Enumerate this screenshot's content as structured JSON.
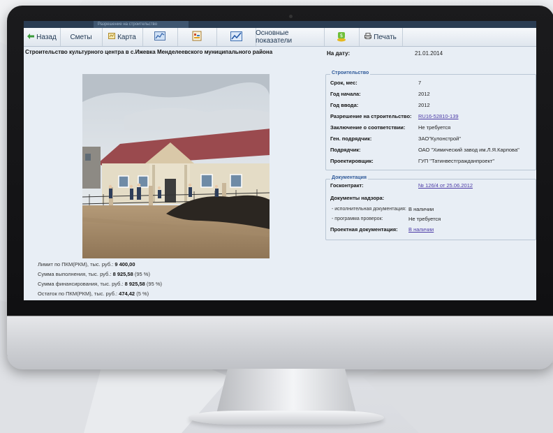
{
  "tab_fragment": "Разрешение на строительство",
  "toolbar": {
    "back_label": "Назад",
    "estimates_label": "Сметы",
    "map_label": "Карта",
    "indicators_label": "Основные показатели",
    "print_label": "Печать"
  },
  "page": {
    "title": "Строительство культурного центра в с.Ижевка Менделеевского муниципального района",
    "date_label": "На дату:",
    "date_value": "21.01.2014"
  },
  "construction": {
    "legend": "Строительство",
    "rows": [
      {
        "label": "Срок, мес:",
        "value": "7"
      },
      {
        "label": "Год начала:",
        "value": "2012"
      },
      {
        "label": "Год ввода:",
        "value": "2012"
      },
      {
        "label": "Разрешение на строительство:",
        "value": "RU16-52810-139"
      },
      {
        "label": "Заключение о соответствии:",
        "value": "Не требуется"
      },
      {
        "label": "Ген. подрядчик:",
        "value": "ЗАО\"Кулонстрой\""
      },
      {
        "label": "Подрядчик:",
        "value": "ОАО \"Химический завод им.Л.Я.Карпова\""
      },
      {
        "label": "Проектировщик:",
        "value": "ГУП \"Татинвестгражданпроект\""
      }
    ]
  },
  "documentation": {
    "legend": "Документация",
    "contract_label": "Госконтракт:",
    "contract_value": "№ 126/4 от 25.06.2012",
    "supervision_label": "Документы надзора:",
    "exec_label": "- исполнительная документация:",
    "exec_value": "В наличии",
    "inspect_label": "- программа проверок:",
    "inspect_value": "Не требуется",
    "project_label": "Проектная документация:",
    "project_value": "В наличии"
  },
  "finance": {
    "limit_label": "Лимит по ПКМ(РКМ), тыс. руб.:",
    "limit_value": "9 400,00",
    "done_label": "Сумма выполнения, тыс. руб.:",
    "done_value": "8 925,58",
    "done_pct": "(95 %)",
    "funded_label": "Сумма финансирования, тыс. руб.:",
    "funded_value": "8 925,58",
    "funded_pct": "(95 %)",
    "rest_label": "Остаток по ПКМ(РКМ), тыс. руб.:",
    "rest_value": "474,42",
    "rest_pct": "(5 %)"
  },
  "colors": {
    "link": "#4b3aa6",
    "legend": "#2f5a9a",
    "screen_bg": "#e8eef5"
  }
}
